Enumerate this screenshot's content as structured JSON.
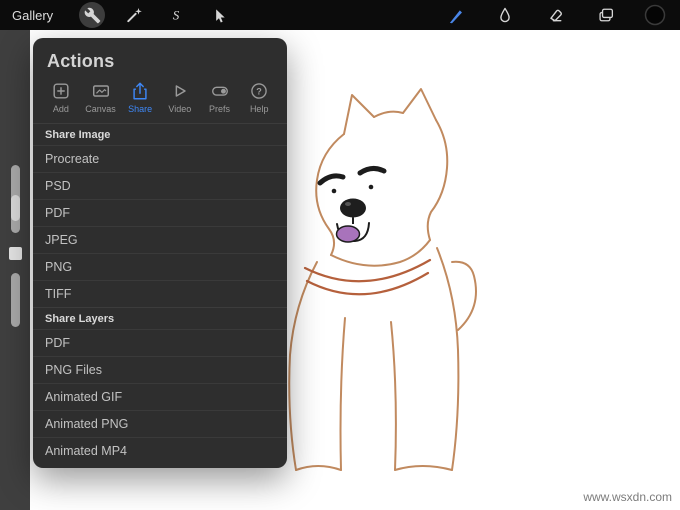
{
  "topbar": {
    "gallery_label": "Gallery",
    "left_tools": [
      "actions",
      "adjustments",
      "selection",
      "transform"
    ],
    "active_left_tool": "actions",
    "right_tools": [
      "paint",
      "smudge",
      "erase",
      "layers",
      "color"
    ],
    "color_swatch_color": "#0a0a0a"
  },
  "panel": {
    "title": "Actions",
    "active_tab": "Share",
    "tabs": [
      {
        "label": "Add",
        "icon": "add-icon"
      },
      {
        "label": "Canvas",
        "icon": "canvas-icon"
      },
      {
        "label": "Share",
        "icon": "share-icon"
      },
      {
        "label": "Video",
        "icon": "video-icon"
      },
      {
        "label": "Prefs",
        "icon": "prefs-icon"
      },
      {
        "label": "Help",
        "icon": "help-icon"
      }
    ],
    "sections": [
      {
        "header": "Share Image",
        "items": [
          "Procreate",
          "PSD",
          "PDF",
          "JPEG",
          "PNG",
          "TIFF"
        ]
      },
      {
        "header": "Share Layers",
        "items": [
          "PDF",
          "PNG Files",
          "Animated GIF",
          "Animated PNG",
          "Animated MP4"
        ]
      }
    ]
  },
  "watermark": "www.wsxdn.com",
  "colors": {
    "accent_blue": "#3e87f5",
    "topbar_bg": "#0c0c0c",
    "panel_bg": "#2e2e2e",
    "dog_outline": "#c18a5f",
    "dog_tongue": "#a873bb",
    "dog_collar": "#b5603c"
  }
}
